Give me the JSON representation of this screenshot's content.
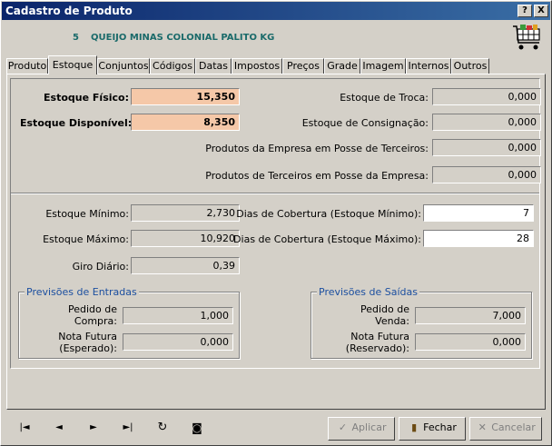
{
  "window": {
    "title": "Cadastro de Produto",
    "help_label": "?",
    "close_label": "X"
  },
  "product": {
    "code": "5",
    "name": "QUEIJO MINAS COLONIAL PALITO KG"
  },
  "tabs": [
    "Produto",
    "Estoque",
    "Conjuntos",
    "Códigos",
    "Datas",
    "Impostos",
    "Preços",
    "Grade",
    "Imagem",
    "Internos",
    "Outros"
  ],
  "estoque": {
    "fisico_label": "Estoque Físico:",
    "fisico_value": "15,350",
    "disponivel_label": "Estoque Disponível:",
    "disponivel_value": "8,350",
    "troca_label": "Estoque de Troca:",
    "troca_value": "0,000",
    "consignacao_label": "Estoque de Consignação:",
    "consignacao_value": "0,000",
    "empresa_terceiros_label": "Produtos da Empresa em Posse de Terceiros:",
    "empresa_terceiros_value": "0,000",
    "terceiros_empresa_label": "Produtos de Terceiros em Posse da Empresa:",
    "terceiros_empresa_value": "0,000",
    "minimo_label": "Estoque Mínimo:",
    "minimo_value": "2,730",
    "maximo_label": "Estoque Máximo:",
    "maximo_value": "10,920",
    "giro_label": "Giro Diário:",
    "giro_value": "0,39",
    "cob_min_label": "Dias de Cobertura (Estoque Mínimo):",
    "cob_min_value": "7",
    "cob_max_label": "Dias de Cobertura (Estoque Máximo):",
    "cob_max_value": "28"
  },
  "entradas": {
    "title": "Previsões de Entradas",
    "pedido_label_1": "Pedido de",
    "pedido_label_2": "Compra:",
    "pedido_value": "1,000",
    "nota_label_1": "Nota Futura",
    "nota_label_2": "(Esperado):",
    "nota_value": "0,000"
  },
  "saidas": {
    "title": "Previsões de Saídas",
    "pedido_label_1": "Pedido de",
    "pedido_label_2": "Venda:",
    "pedido_value": "7,000",
    "nota_label_1": "Nota Futura",
    "nota_label_2": "(Reservado):",
    "nota_value": "0,000"
  },
  "nav": {
    "first": "|◄",
    "prev": "◄",
    "next": "►",
    "last": "►|",
    "refresh": "↻",
    "history": "◙"
  },
  "actions": {
    "apply": "Aplicar",
    "close": "Fechar",
    "cancel": "Cancelar"
  },
  "icons": {
    "cart": "shopping-cart-icon",
    "apply": "apply-icon",
    "close": "door-icon",
    "cancel": "cancel-x-icon"
  }
}
